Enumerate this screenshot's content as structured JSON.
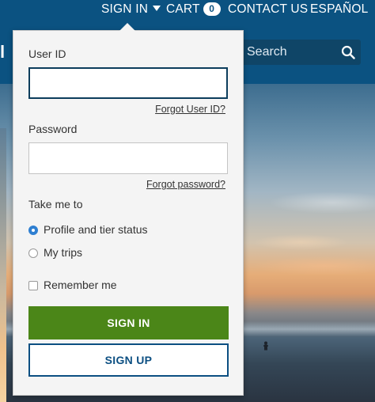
{
  "nav": {
    "sign_in": "SIGN IN",
    "cart": "CART",
    "cart_count": "0",
    "contact_us": "CONTACT US",
    "espanol": "ESPAÑOL"
  },
  "header": {
    "logo_fragment": "l",
    "search_placeholder": "Search"
  },
  "signin_form": {
    "user_id_label": "User ID",
    "user_id_value": "",
    "forgot_user_id": "Forgot User ID?",
    "password_label": "Password",
    "password_value": "",
    "forgot_password": "Forgot password?",
    "take_me_to_label": "Take me to",
    "options": [
      {
        "label": "Profile and tier status",
        "selected": true
      },
      {
        "label": "My trips",
        "selected": false
      }
    ],
    "remember_me": "Remember me",
    "remember_me_checked": false,
    "sign_in_button": "SIGN IN",
    "sign_up_button": "SIGN UP"
  },
  "colors": {
    "brand_blue": "#0b5281",
    "sign_in_green": "#4b8618",
    "radio_blue": "#2e7fd1"
  },
  "icons": {
    "search": "search-icon",
    "caret": "caret-down-icon"
  }
}
